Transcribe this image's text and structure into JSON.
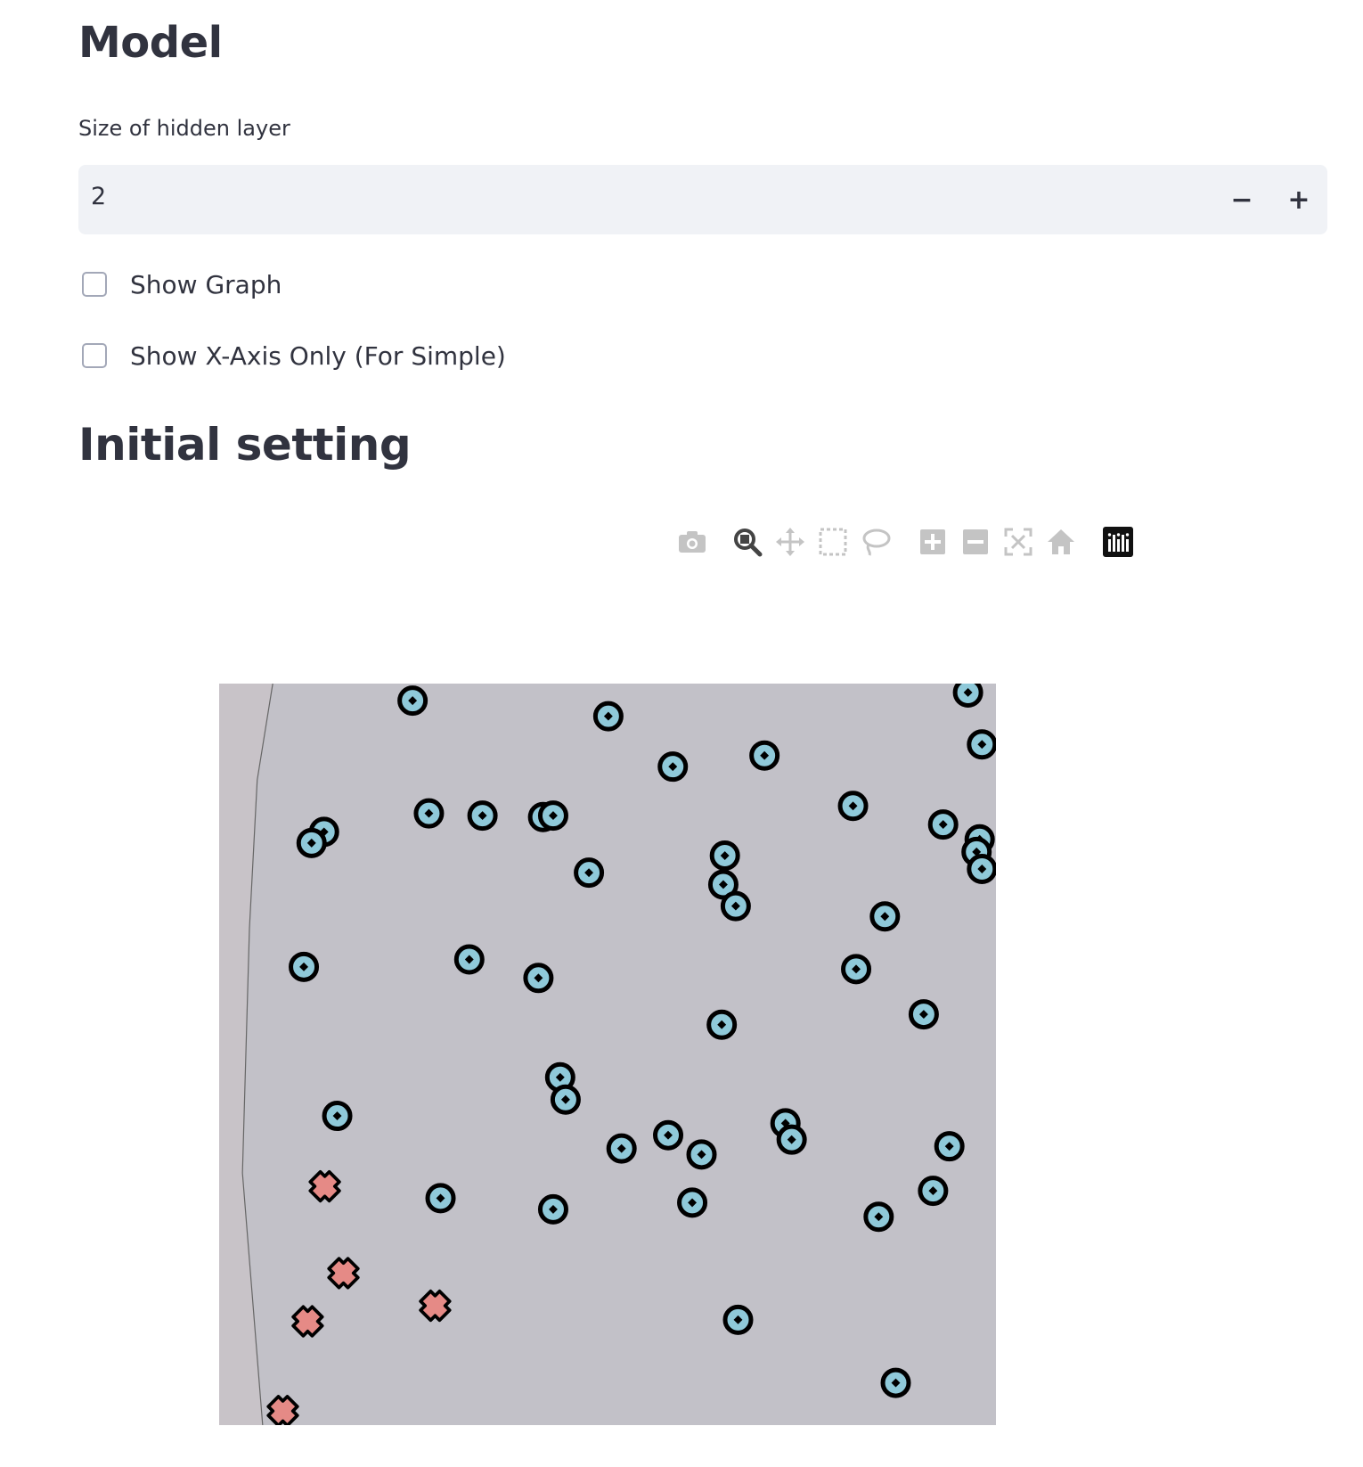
{
  "model_section": {
    "title": "Model",
    "hidden_layer": {
      "label": "Size of hidden layer",
      "value": "2",
      "decrement_label": "−",
      "increment_label": "+"
    },
    "show_graph": {
      "label": "Show Graph",
      "checked": false
    },
    "show_x_axis_only": {
      "label": "Show X-Axis Only (For Simple)",
      "checked": false
    }
  },
  "initial_section": {
    "title": "Initial setting"
  },
  "modebar": {
    "buttons": [
      {
        "name": "camera-icon",
        "title": "Download plot as a png"
      },
      {
        "name": "zoom-icon",
        "title": "Zoom",
        "active": true
      },
      {
        "name": "pan-icon",
        "title": "Pan"
      },
      {
        "name": "box-select-icon",
        "title": "Box Select"
      },
      {
        "name": "lasso-select-icon",
        "title": "Lasso Select"
      },
      {
        "name": "zoom-in-icon",
        "title": "Zoom in"
      },
      {
        "name": "zoom-out-icon",
        "title": "Zoom out"
      },
      {
        "name": "autoscale-icon",
        "title": "Autoscale"
      },
      {
        "name": "reset-axes-icon",
        "title": "Reset axes"
      },
      {
        "name": "plotly-logo-icon",
        "title": "Produced with Plotly"
      }
    ]
  },
  "chart_data": {
    "type": "scatter",
    "title": "",
    "xlabel": "",
    "ylabel": "",
    "xlim": [
      0,
      100
    ],
    "ylim": [
      0,
      100
    ],
    "grid": false,
    "background_colors": {
      "region_a": "#c8c3c8",
      "region_b": "#c2c1c8"
    },
    "decision_boundary": {
      "x": [
        6.9,
        4.9,
        3.9,
        3.0,
        5.6
      ],
      "y": [
        100,
        87,
        67,
        34,
        0
      ]
    },
    "series": [
      {
        "marker": "circle-dot",
        "color": "#8fc9d9",
        "x": [
          24.9,
          50.1,
          96.4,
          98.2,
          58.4,
          70.2,
          13.5,
          11.9,
          27.0,
          33.9,
          41.7,
          43.0,
          47.6,
          81.6,
          93.2,
          97.9,
          97.5,
          98.2,
          65.1,
          64.9,
          66.5,
          85.7,
          10.9,
          32.2,
          41.1,
          82.0,
          90.7,
          64.7,
          43.9,
          44.6,
          72.9,
          73.7,
          15.2,
          51.8,
          57.8,
          62.1,
          94.0,
          28.5,
          43.0,
          60.9,
          91.9,
          84.9,
          66.8,
          87.1
        ],
        "y": [
          97.7,
          95.6,
          98.8,
          91.8,
          88.8,
          90.3,
          80.0,
          78.5,
          82.5,
          82.2,
          82.0,
          82.2,
          74.5,
          83.5,
          81.0,
          79.0,
          77.3,
          75.0,
          76.8,
          72.9,
          70.0,
          68.6,
          61.8,
          62.8,
          60.3,
          61.5,
          55.4,
          54.0,
          46.9,
          43.9,
          40.7,
          38.5,
          41.7,
          37.3,
          39.1,
          36.5,
          37.6,
          30.6,
          29.1,
          30.0,
          31.6,
          28.1,
          14.2,
          5.7
        ]
      },
      {
        "marker": "x",
        "color": "#e58a86",
        "x": [
          13.6,
          16.0,
          11.4,
          27.8,
          8.2
        ],
        "y": [
          32.2,
          20.5,
          14.0,
          16.1,
          1.9
        ]
      }
    ]
  }
}
